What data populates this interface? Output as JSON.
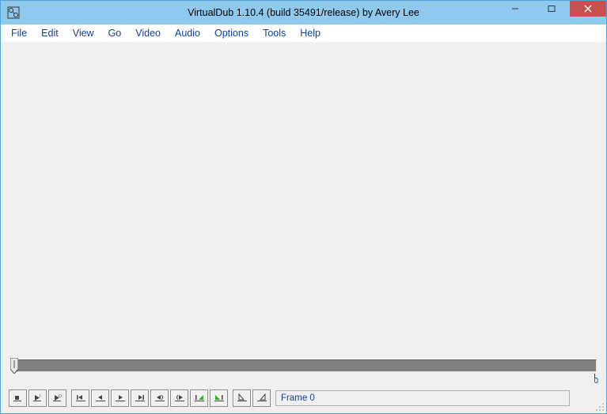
{
  "window": {
    "title": "VirtualDub 1.10.4 (build 35491/release) by Avery Lee"
  },
  "menu": {
    "items": [
      "File",
      "Edit",
      "View",
      "Go",
      "Video",
      "Audio",
      "Options",
      "Tools",
      "Help"
    ]
  },
  "timeline": {
    "position": 0,
    "end_label": "0"
  },
  "toolbar": {
    "buttons": [
      "stop",
      "play-input",
      "play-output",
      "go-start",
      "step-back",
      "step-forward",
      "go-end",
      "prev-keyframe",
      "next-keyframe",
      "prev-drop",
      "next-drop",
      "mark-in",
      "mark-out"
    ]
  },
  "status": {
    "frame_label": "Frame 0"
  }
}
